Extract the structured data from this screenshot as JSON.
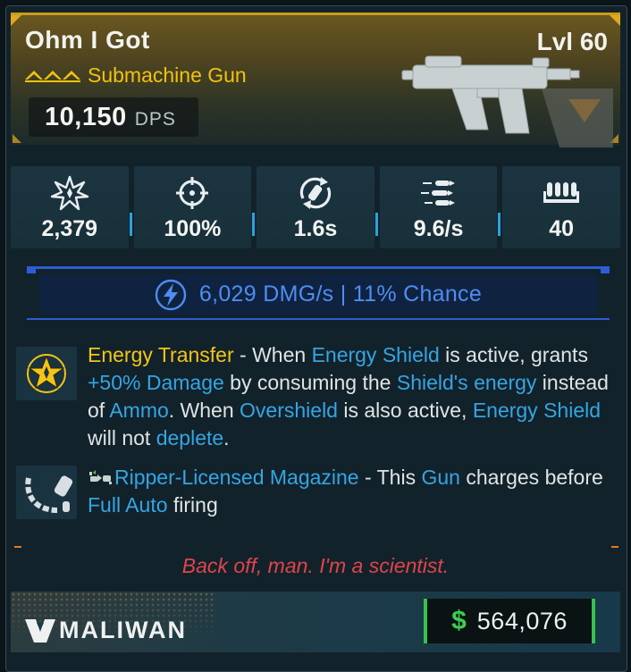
{
  "item": {
    "name": "Ohm I Got",
    "level": "Lvl 60",
    "type": "Submachine Gun",
    "dps_value": "10,150",
    "dps_unit": "DPS",
    "rarity_color": "#f1c20f"
  },
  "stats": [
    {
      "icon": "damage-burst-icon",
      "value": "2,379"
    },
    {
      "icon": "crosshair-icon",
      "value": "100%"
    },
    {
      "icon": "reload-icon",
      "value": "1.6s"
    },
    {
      "icon": "fire-rate-icon",
      "value": "9.6/s"
    },
    {
      "icon": "magazine-icon",
      "value": "40"
    }
  ],
  "element": {
    "icon": "shock-bolt-icon",
    "text": "6,029 DMG/s | 11% Chance",
    "color": "#2f5cd6"
  },
  "perks": [
    {
      "icon": "star-badge-icon",
      "title": "Energy Transfer",
      "segments": [
        {
          "text": " - When ",
          "style": "plain"
        },
        {
          "text": "Energy Shield",
          "style": "blue"
        },
        {
          "text": " is active, grants ",
          "style": "plain"
        },
        {
          "text": "+50% Damage",
          "style": "blue"
        },
        {
          "text": " by consuming the ",
          "style": "plain"
        },
        {
          "text": "Shield's energy",
          "style": "blue"
        },
        {
          "text": " instead of ",
          "style": "plain"
        },
        {
          "text": "Ammo",
          "style": "blue"
        },
        {
          "text": ". When ",
          "style": "plain"
        },
        {
          "text": "Overshield",
          "style": "blue"
        },
        {
          "text": " is also active, ",
          "style": "plain"
        },
        {
          "text": "Energy Shield",
          "style": "blue"
        },
        {
          "text": " will not ",
          "style": "plain"
        },
        {
          "text": "deplete",
          "style": "blue"
        },
        {
          "text": ".",
          "style": "plain"
        }
      ]
    },
    {
      "icon": "curved-magazine-icon",
      "manufacturer_icon": "ripper-logo-icon",
      "title": "Ripper-Licensed Magazine",
      "segments": [
        {
          "text": " - This ",
          "style": "plain"
        },
        {
          "text": "Gun",
          "style": "blue"
        },
        {
          "text": " charges before ",
          "style": "plain"
        },
        {
          "text": "Full Auto",
          "style": "blue"
        },
        {
          "text": " firing",
          "style": "plain"
        }
      ]
    }
  ],
  "flavor_text": "Back off, man. I'm a scientist.",
  "footer": {
    "manufacturer": "MALIWAN",
    "price_symbol": "$",
    "price": "564,076"
  }
}
